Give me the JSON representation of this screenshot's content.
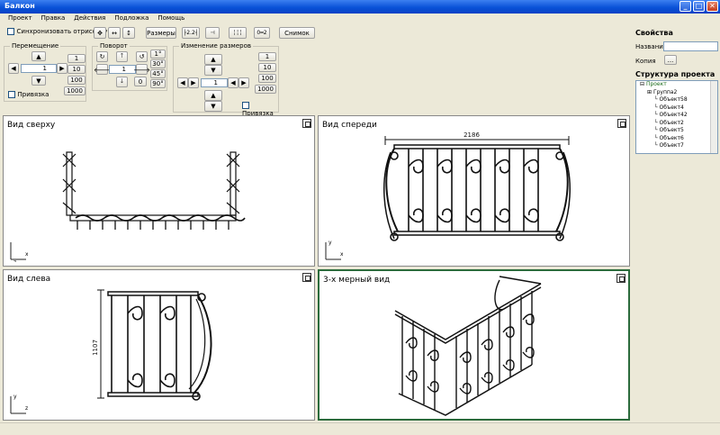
{
  "window": {
    "title": "Балкон",
    "min": "_",
    "max": "□",
    "close": "✕"
  },
  "menu": [
    "Проект",
    "Правка",
    "Действия",
    "Подложка",
    "Помощь"
  ],
  "toolbar": {
    "sync_label": "Синхронизовать отрисовку",
    "sizes_label": "Размеры",
    "snapshot_label": "Снимок"
  },
  "move": {
    "title": "Перемещение",
    "value": "1",
    "steps": [
      "1",
      "10",
      "100",
      "1000"
    ],
    "snap": "Привязка"
  },
  "rotate": {
    "title": "Поворот",
    "value": "1",
    "zero": "0",
    "angles": [
      "1°",
      "30°",
      "45°",
      "90°"
    ]
  },
  "resize": {
    "title": "Изменение размеров",
    "value": "1",
    "steps": [
      "1",
      "10",
      "100",
      "1000"
    ],
    "snap": "Привязка"
  },
  "properties": {
    "title": "Свойства",
    "name_label": "Название",
    "name_value": "",
    "copy_label": "Копия",
    "copy_btn": "..."
  },
  "structure": {
    "title": "Структура проекта",
    "items": [
      "Проект",
      "Группа2",
      "Объект58",
      "Объект4",
      "Объект42",
      "Объект2",
      "Объект5",
      "Объект6",
      "Объект7"
    ]
  },
  "views": {
    "top": {
      "title": "Вид сверху",
      "axis_h": "x",
      "axis_v": "z"
    },
    "front": {
      "title": "Вид спереди",
      "axis_h": "x",
      "axis_v": "y",
      "dimension": "2186"
    },
    "left": {
      "title": "Вид слева",
      "axis_h": "z",
      "axis_v": "y",
      "dimension": "1107"
    },
    "iso": {
      "title": "3-х мерный вид"
    }
  },
  "colors": {
    "titlebar": "#0a52d8",
    "active_view_border": "#2b6b3c",
    "window_bg": "#ece9d8"
  },
  "icons": [
    "move-cross-icon",
    "move-horizontal-icon",
    "move-vertical-icon",
    "dimension-icon",
    "align-icon",
    "arrow-up-icon",
    "arrow-down-icon",
    "arrow-left-icon",
    "arrow-right-icon",
    "rotate-cw-icon",
    "rotate-ccw-icon",
    "maximize-view-icon"
  ]
}
